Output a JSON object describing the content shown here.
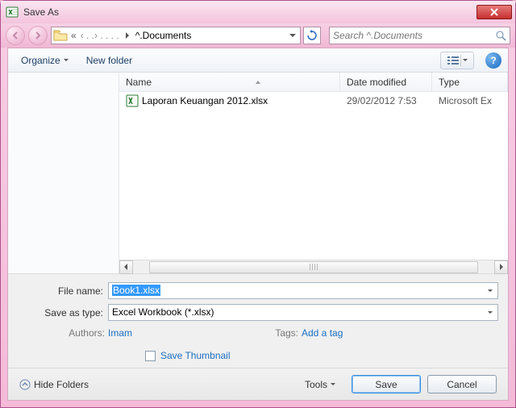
{
  "window": {
    "title": "Save As"
  },
  "nav": {
    "crumb_prefix": "«",
    "crumb_mid": "‹ . .› .  . . .",
    "crumb_folder": "^.Documents",
    "search_placeholder": "Search ^.Documents"
  },
  "toolbar": {
    "organize": "Organize",
    "new_folder": "New folder"
  },
  "columns": {
    "name": "Name",
    "date": "Date modified",
    "type": "Type"
  },
  "rows": [
    {
      "name": "Laporan Keuangan 2012.xlsx",
      "date": "29/02/2012 7:53",
      "type": "Microsoft Ex"
    }
  ],
  "form": {
    "filename_label": "File name:",
    "filename_value": "Book1.xlsx",
    "saveastype_label": "Save as type:",
    "saveastype_value": "Excel Workbook (*.xlsx)"
  },
  "meta": {
    "authors_label": "Authors:",
    "authors_value": "Imam",
    "tags_label": "Tags:",
    "tags_value": "Add a tag",
    "save_thumbnail": "Save Thumbnail"
  },
  "footer": {
    "hide_folders": "Hide Folders",
    "tools": "Tools",
    "save": "Save",
    "cancel": "Cancel"
  },
  "help_glyph": "?"
}
